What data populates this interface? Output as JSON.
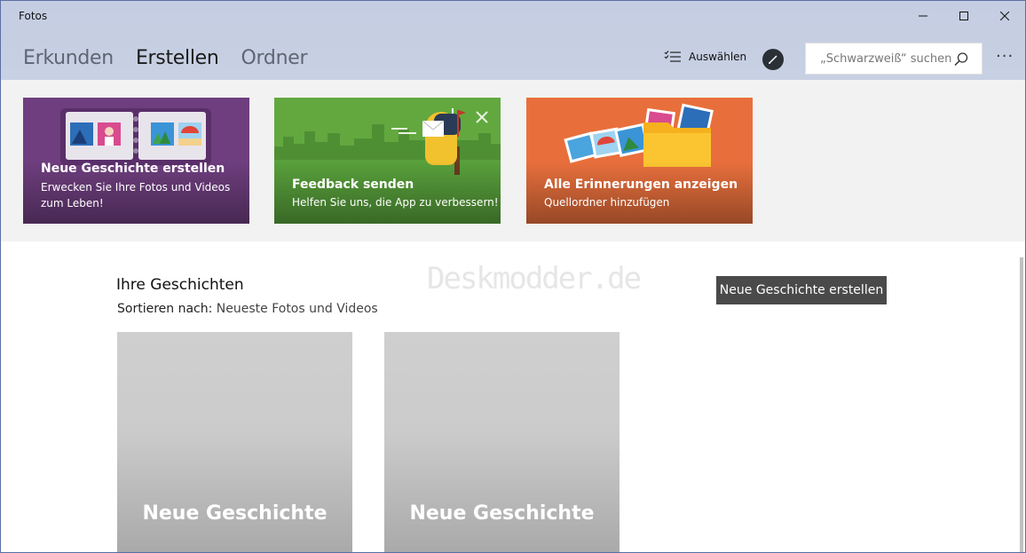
{
  "window": {
    "title": "Fotos"
  },
  "nav": {
    "tabs": [
      {
        "label": "Erkunden",
        "active": false
      },
      {
        "label": "Erstellen",
        "active": true
      },
      {
        "label": "Ordner",
        "active": false
      }
    ]
  },
  "toolbar": {
    "select_label": "Auswählen",
    "search_placeholder": "„Schwarzweiß“ suchen",
    "more_label": "···"
  },
  "banners": [
    {
      "title": "Neue Geschichte erstellen",
      "subtitle": "Erwecken Sie Ihre Fotos und Videos zum Leben!",
      "color": "#6e3e7e"
    },
    {
      "title": "Feedback senden",
      "subtitle": "Helfen Sie uns, die App zu verbessern!",
      "color": "#62a83f"
    },
    {
      "title": "Alle Erinnerungen anzeigen",
      "subtitle": "Quellordner hinzufügen",
      "color": "#e86f3c"
    }
  ],
  "stories": {
    "title": "Ihre Geschichten",
    "sort_prefix": "Sortieren nach:",
    "sort_value": "Neueste Fotos und Videos",
    "create_button": "Neue Geschichte erstellen",
    "watermark": "Deskmodder.de",
    "items": [
      {
        "label": "Neue Geschichte"
      },
      {
        "label": "Neue Geschichte"
      }
    ]
  }
}
